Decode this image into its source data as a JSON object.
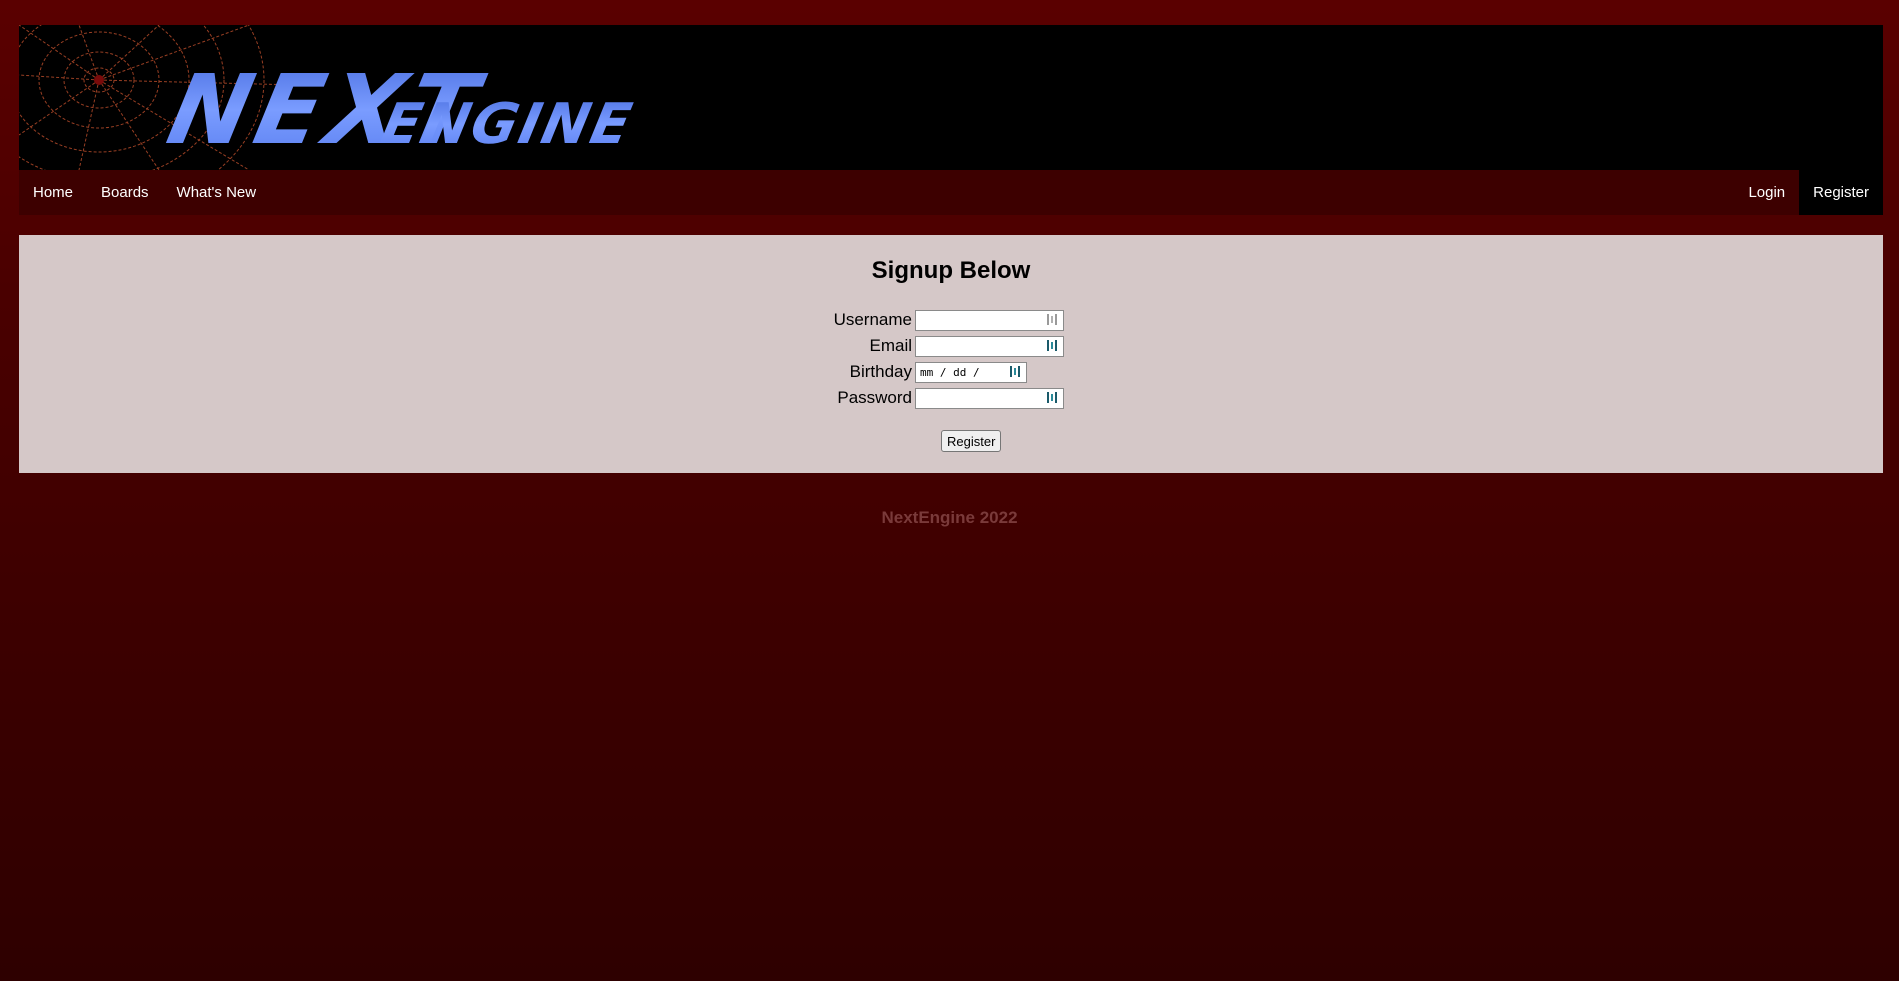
{
  "header": {
    "logo_text_large": "NEXT",
    "logo_text_small": "ENGINE",
    "logo_color": "#6a8cff"
  },
  "nav": {
    "left": [
      {
        "label": "Home"
      },
      {
        "label": "Boards"
      },
      {
        "label": "What's New"
      }
    ],
    "right": [
      {
        "label": "Login",
        "active": false
      },
      {
        "label": "Register",
        "active": true
      }
    ]
  },
  "form": {
    "title": "Signup Below",
    "fields": [
      {
        "label": "Username",
        "value": ""
      },
      {
        "label": "Email",
        "value": ""
      },
      {
        "label": "Birthday",
        "value": "mm / dd / yyyy"
      },
      {
        "label": "Password",
        "value": ""
      }
    ],
    "submit_label": "Register"
  },
  "footer": {
    "text": "NextEngine 2022"
  },
  "colors": {
    "page_bg": "#4a0000",
    "nav_bg": "#3d0000",
    "content_bg": "#d5c8c8",
    "footer_text": "#7a3a3a"
  }
}
